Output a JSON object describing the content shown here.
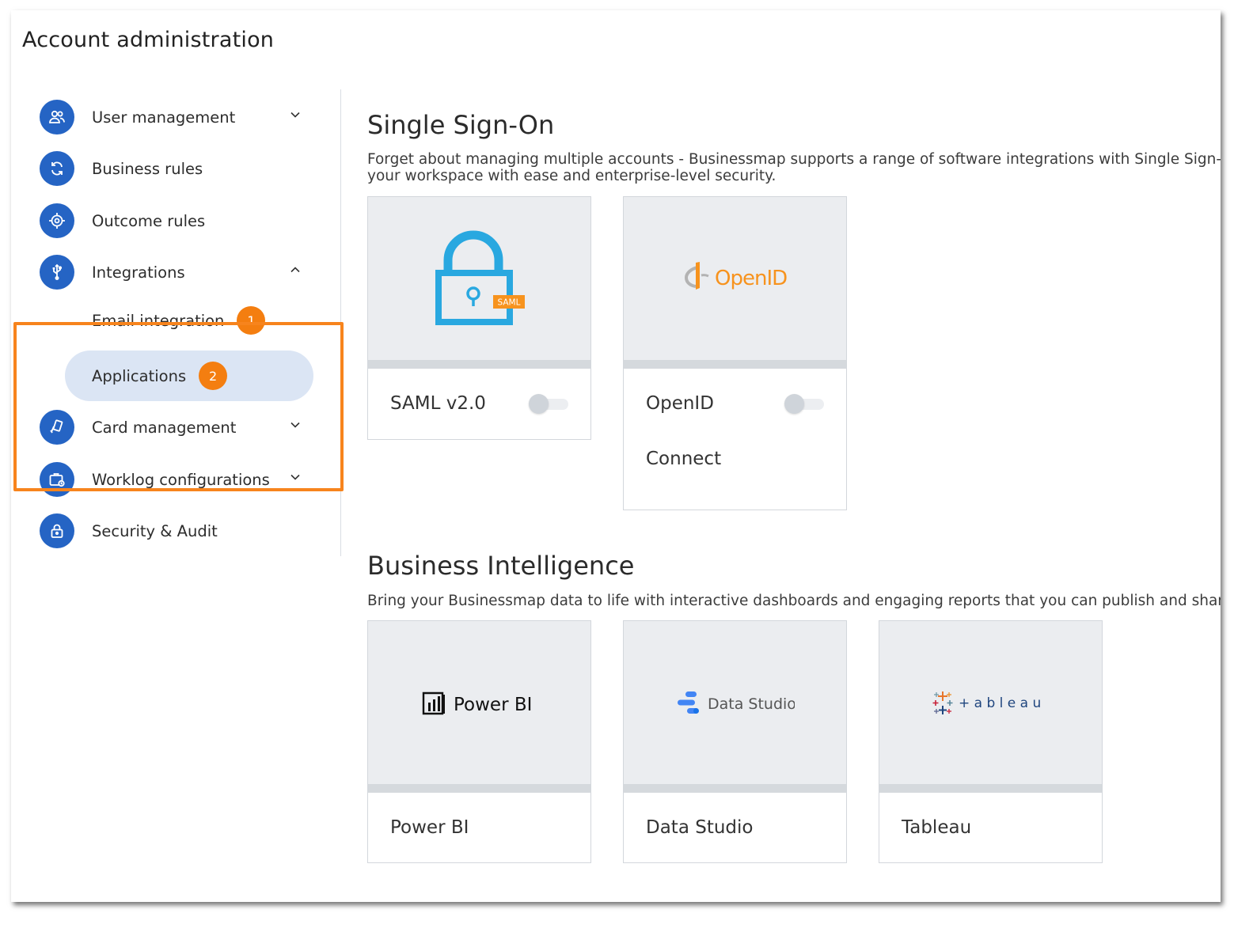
{
  "page": {
    "title": "Account administration"
  },
  "sidebar": {
    "items": [
      {
        "label": "User management",
        "icon": "users-icon",
        "expandable": true
      },
      {
        "label": "Business rules",
        "icon": "sync-icon",
        "expandable": false
      },
      {
        "label": "Outcome rules",
        "icon": "target-icon",
        "expandable": false
      },
      {
        "label": "Integrations",
        "icon": "usb-icon",
        "expandable": true,
        "expanded": true,
        "children": [
          {
            "label": "Email integration",
            "badge": "1"
          },
          {
            "label": "Applications",
            "badge": "2",
            "active": true
          }
        ]
      },
      {
        "label": "Card management",
        "icon": "card-icon",
        "expandable": true
      },
      {
        "label": "Worklog configurations",
        "icon": "worklog-icon",
        "expandable": true
      },
      {
        "label": "Security & Audit",
        "icon": "lock-icon",
        "expandable": false
      }
    ]
  },
  "sso": {
    "title": "Single Sign-On",
    "description_line1": "Forget about managing multiple accounts - Businessmap supports a range of software integrations with Single Sign-on se",
    "description_line2": "your workspace with ease and enterprise-level security.",
    "cards": [
      {
        "name": "SAML v2.0",
        "logo": "saml-logo",
        "logo_tag": "SAML",
        "enabled": false
      },
      {
        "name_line1": "OpenID",
        "name_line2": "Connect",
        "logo": "openid-logo",
        "logo_text": "OpenID",
        "enabled": false
      }
    ]
  },
  "bi": {
    "title": "Business Intelligence",
    "description": "Bring your Businessmap data to life with interactive dashboards and engaging reports that you can publish and share.",
    "cards": [
      {
        "name": "Power BI",
        "logo": "powerbi-logo",
        "logo_text": "Power BI"
      },
      {
        "name": "Data Studio",
        "logo": "datastudio-logo",
        "logo_text": "Data Studio"
      },
      {
        "name": "Tableau",
        "logo": "tableau-logo",
        "logo_text": "+ a b l e a u"
      }
    ]
  },
  "colors": {
    "accent": "#2564c4",
    "highlight": "#f7841d",
    "active_bg": "#dbe5f4",
    "badge": "#f47e10",
    "openid_orange": "#f7931e",
    "saml_blue": "#29a8e0"
  }
}
